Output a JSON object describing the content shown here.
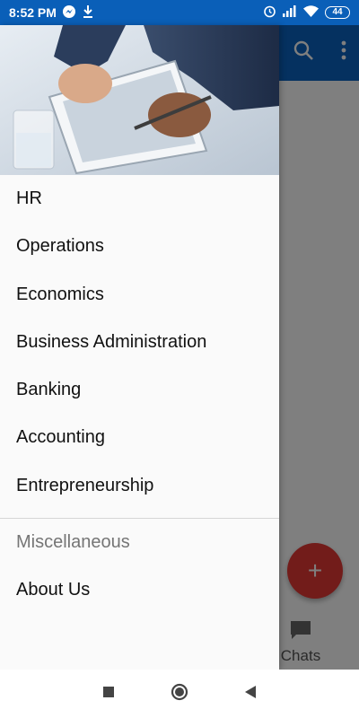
{
  "status_bar": {
    "time": "8:52 PM",
    "battery": "44",
    "icons": [
      "messenger-icon",
      "download-icon",
      "alarm-icon",
      "signal-icon",
      "wifi-icon",
      "battery-icon"
    ]
  },
  "app": {
    "toolbar_icons": [
      "search-icon",
      "more-vert-icon"
    ],
    "fab_label": "+",
    "bottom_tab_label": "Chats",
    "colors": {
      "toolbar": "#0a62c0",
      "status_bar": "#0a5fb8",
      "fab": "#e53935"
    }
  },
  "drawer": {
    "header_image": "business-tablet-image",
    "items": [
      {
        "label": "HR"
      },
      {
        "label": "Operations"
      },
      {
        "label": "Economics"
      },
      {
        "label": "Business Administration"
      },
      {
        "label": "Banking"
      },
      {
        "label": "Accounting"
      },
      {
        "label": "Entrepreneurship"
      }
    ],
    "section_label": "Miscellaneous",
    "section_items": [
      {
        "label": "About Us"
      }
    ]
  },
  "nav_bar": {
    "buttons": [
      "recents-square-icon",
      "home-circle-icon",
      "back-triangle-icon"
    ]
  }
}
